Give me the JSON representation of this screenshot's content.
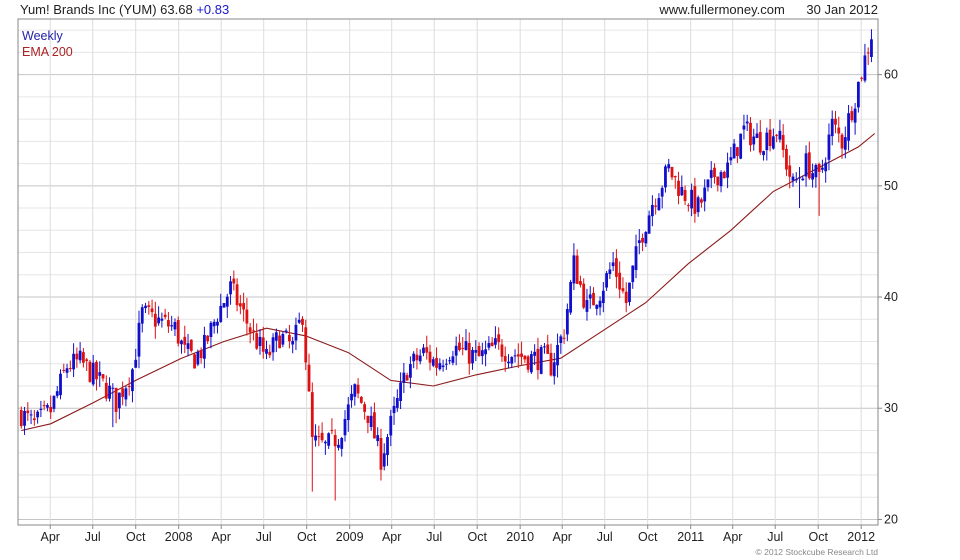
{
  "header": {
    "name": "Yum! Brands Inc (YUM)",
    "price": "63.68",
    "change": "+0.83",
    "site": "www.fullermoney.com",
    "date": "30 Jan 2012"
  },
  "legend": {
    "weekly": "Weekly",
    "ema": "EMA 200"
  },
  "copyright": "© 2012 Stockcube Research Ltd",
  "chart_data": {
    "type": "candlestick",
    "frequency": "weekly",
    "x_tick_labels": [
      "Apr",
      "Jul",
      "Oct",
      "2008",
      "Apr",
      "Jul",
      "Oct",
      "2009",
      "Apr",
      "Jul",
      "Oct",
      "2010",
      "Apr",
      "Jul",
      "Oct",
      "2011",
      "Apr",
      "Jul",
      "Oct",
      "2012"
    ],
    "x_tick_dates": [
      "2007-04-01",
      "2007-07-01",
      "2007-10-01",
      "2008-01-01",
      "2008-04-01",
      "2008-07-01",
      "2008-10-01",
      "2009-01-01",
      "2009-04-01",
      "2009-07-01",
      "2009-10-01",
      "2010-01-01",
      "2010-04-01",
      "2010-07-01",
      "2010-10-01",
      "2011-01-01",
      "2011-04-01",
      "2011-07-01",
      "2011-10-01",
      "2012-01-01"
    ],
    "y_ticks": [
      20,
      30,
      40,
      50,
      60
    ],
    "ylim": [
      19.5,
      65
    ],
    "xlim": [
      "2007-01-22",
      "2012-02-06"
    ],
    "grid": true,
    "colors": {
      "up": "#1010cc",
      "down": "#dd1111",
      "ema": "#8b1a1a",
      "grid": "#d8d8d8"
    },
    "close_path": [
      [
        "2007-01-29",
        29.5
      ],
      [
        "2007-02-26",
        28.5
      ],
      [
        "2007-04-02",
        29.8
      ],
      [
        "2007-05-07",
        33.8
      ],
      [
        "2007-06-04",
        34.2
      ],
      [
        "2007-07-02",
        33.0
      ],
      [
        "2007-08-06",
        31.5
      ],
      [
        "2007-08-20",
        30.5
      ],
      [
        "2007-09-24",
        33.5
      ],
      [
        "2007-10-15",
        38.5
      ],
      [
        "2007-11-12",
        38.0
      ],
      [
        "2007-12-24",
        37.2
      ],
      [
        "2008-01-14",
        35.0
      ],
      [
        "2008-02-04",
        34.5
      ],
      [
        "2008-02-25",
        35.5
      ],
      [
        "2008-03-24",
        38.5
      ],
      [
        "2008-04-21",
        40.8
      ],
      [
        "2008-05-12",
        39.0
      ],
      [
        "2008-06-09",
        36.5
      ],
      [
        "2008-07-07",
        34.5
      ],
      [
        "2008-08-04",
        36.5
      ],
      [
        "2008-09-01",
        35.5
      ],
      [
        "2008-09-22",
        38.5
      ],
      [
        "2008-10-13",
        27.0
      ],
      [
        "2008-11-10",
        26.5
      ],
      [
        "2008-12-08",
        27.5
      ],
      [
        "2009-01-12",
        31.5
      ],
      [
        "2009-02-09",
        29.5
      ],
      [
        "2009-03-09",
        25.5
      ],
      [
        "2009-04-06",
        29.5
      ],
      [
        "2009-05-04",
        33.5
      ],
      [
        "2009-06-08",
        35.0
      ],
      [
        "2009-07-06",
        34.0
      ],
      [
        "2009-08-10",
        35.5
      ],
      [
        "2009-09-07",
        35.0
      ],
      [
        "2009-10-05",
        34.5
      ],
      [
        "2009-11-09",
        35.5
      ],
      [
        "2009-12-14",
        35.0
      ],
      [
        "2010-01-18",
        34.5
      ],
      [
        "2010-02-22",
        34.5
      ],
      [
        "2010-03-08",
        33.8
      ],
      [
        "2010-04-05",
        37.0
      ],
      [
        "2010-04-26",
        43.0
      ],
      [
        "2010-05-24",
        39.0
      ],
      [
        "2010-06-21",
        40.5
      ],
      [
        "2010-07-19",
        43.0
      ],
      [
        "2010-08-16",
        39.5
      ],
      [
        "2010-09-13",
        45.0
      ],
      [
        "2010-10-11",
        48.5
      ],
      [
        "2010-11-15",
        51.5
      ],
      [
        "2010-12-13",
        49.5
      ],
      [
        "2011-01-17",
        48.0
      ],
      [
        "2011-02-21",
        51.0
      ],
      [
        "2011-03-21",
        51.5
      ],
      [
        "2011-04-25",
        55.0
      ],
      [
        "2011-05-30",
        54.0
      ],
      [
        "2011-07-04",
        55.0
      ],
      [
        "2011-08-08",
        50.0
      ],
      [
        "2011-09-05",
        52.0
      ],
      [
        "2011-10-03",
        50.5
      ],
      [
        "2011-10-31",
        55.5
      ],
      [
        "2011-11-21",
        54.0
      ],
      [
        "2011-12-19",
        58.0
      ],
      [
        "2012-01-23",
        63.68
      ]
    ],
    "ema_path": [
      [
        "2007-01-29",
        28.0
      ],
      [
        "2007-04-02",
        28.6
      ],
      [
        "2007-07-02",
        30.5
      ],
      [
        "2007-10-01",
        32.5
      ],
      [
        "2008-01-07",
        34.5
      ],
      [
        "2008-04-07",
        36.0
      ],
      [
        "2008-07-07",
        37.2
      ],
      [
        "2008-09-29",
        36.5
      ],
      [
        "2008-12-29",
        35.0
      ],
      [
        "2009-03-30",
        32.5
      ],
      [
        "2009-06-29",
        32.0
      ],
      [
        "2009-09-28",
        33.0
      ],
      [
        "2009-12-28",
        33.8
      ],
      [
        "2010-03-29",
        34.5
      ],
      [
        "2010-06-28",
        37.0
      ],
      [
        "2010-09-27",
        39.5
      ],
      [
        "2010-12-27",
        43.0
      ],
      [
        "2011-03-28",
        46.0
      ],
      [
        "2011-06-27",
        49.5
      ],
      [
        "2011-09-26",
        51.5
      ],
      [
        "2011-12-26",
        53.5
      ],
      [
        "2012-01-30",
        54.7
      ]
    ],
    "dips": [
      [
        "2008-10-13",
        22.5
      ],
      [
        "2008-12-01",
        21.7
      ],
      [
        "2009-03-09",
        23.5
      ],
      [
        "2007-08-13",
        28.3
      ],
      [
        "2011-10-03",
        47.3
      ],
      [
        "2011-08-22",
        48.0
      ]
    ]
  }
}
